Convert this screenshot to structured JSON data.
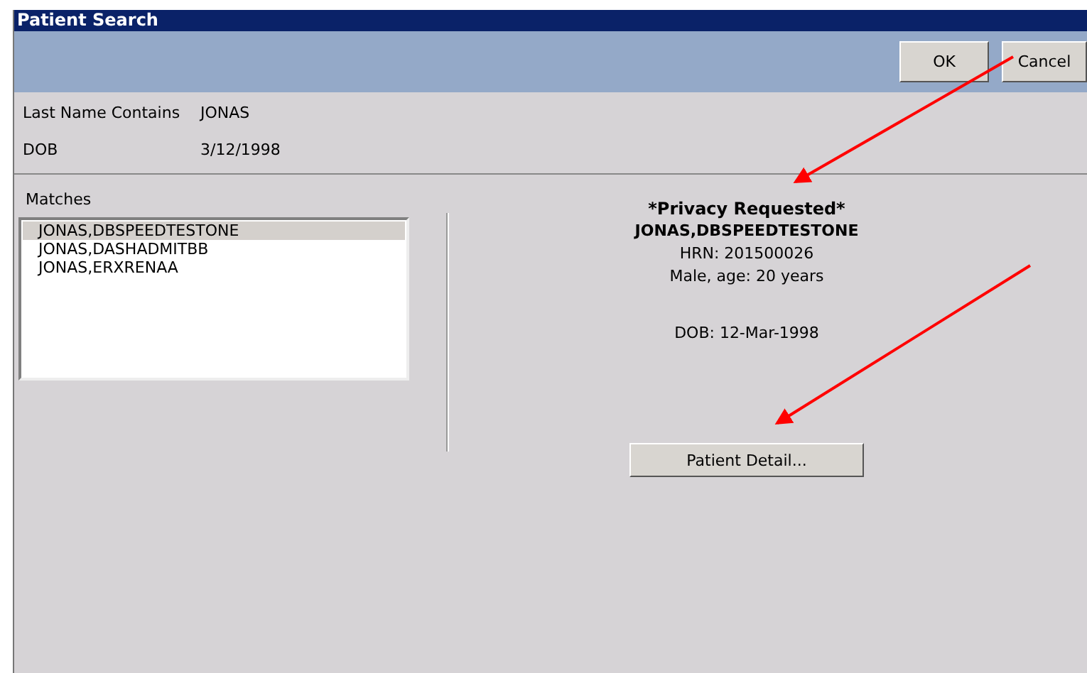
{
  "window": {
    "title": "Patient Search"
  },
  "buttons": [
    {
      "label": "OK"
    },
    {
      "label": "Cancel"
    }
  ],
  "criteria": [
    {
      "label": "Last Name Contains",
      "value": "JONAS"
    },
    {
      "label": "DOB",
      "value": "3/12/1998"
    }
  ],
  "matches": {
    "label": "Matches",
    "items": [
      {
        "name": "JONAS,DBSPEEDTESTONE",
        "selected": true
      },
      {
        "name": "JONAS,DASHADMITBB",
        "selected": false
      },
      {
        "name": "JONAS,ERXRENAA",
        "selected": false
      }
    ]
  },
  "detail": {
    "privacy": "*Privacy Requested*",
    "name": "JONAS,DBSPEEDTESTONE",
    "hrn": "HRN: 201500026",
    "sex_age": "Male, age: 20 years",
    "dob": "DOB: 12-Mar-1998",
    "button": "Patient Detail..."
  }
}
